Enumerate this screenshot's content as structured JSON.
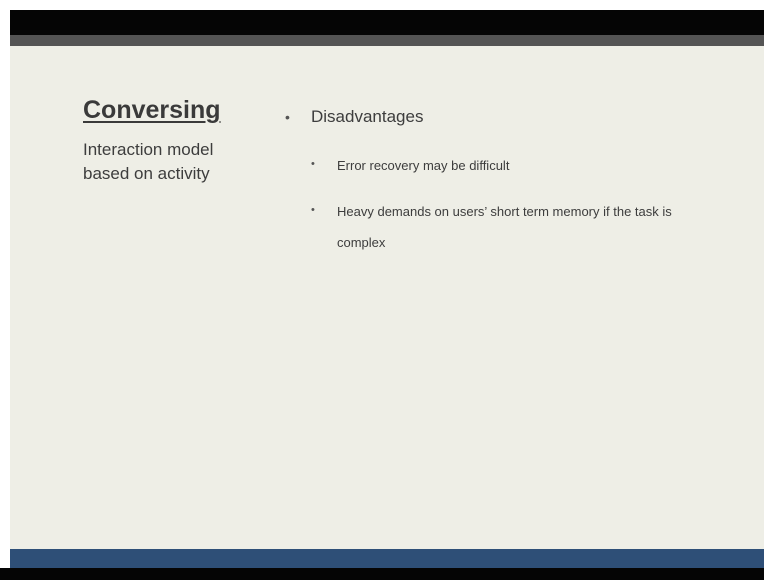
{
  "slide": {
    "title": "Conversing",
    "subtitle": "Interaction model based on activity",
    "main_bullet": "Disadvantages",
    "sub_bullets": [
      "Error recovery may be difficult",
      "Heavy demands on users’ short term memory if the task is complex"
    ],
    "bullet_glyph": "•"
  },
  "colors": {
    "slide_background": "#eeeee6",
    "top_bar": "#050505",
    "top_stripe": "#545454",
    "bottom_bar": "#2e4f77",
    "text": "#3d3d3d"
  }
}
